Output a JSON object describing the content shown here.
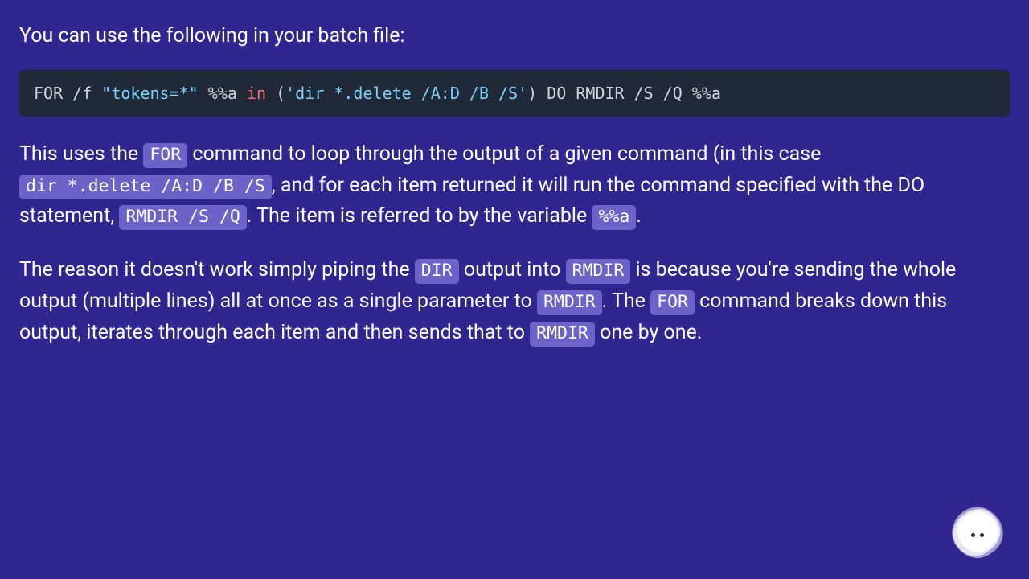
{
  "intro": "You can use the following in your batch file:",
  "code": {
    "t1": "FOR /f ",
    "str": "\"tokens=*\"",
    "t2": " %%a ",
    "kw": "in",
    "t3": " (",
    "str2": "'dir *.delete /A:D /B /S'",
    "t4": ") DO RMDIR /S /Q %%a"
  },
  "p1": {
    "a": "This uses the ",
    "c1": "FOR",
    "b": " command to loop through the output of a given command (in this case ",
    "c2": "dir *.delete /A:D /B /S",
    "c": ", and for each item returned it will run the command specified with the DO statement, ",
    "c3": "RMDIR /S /Q",
    "d": ". The item is referred to by the variable ",
    "c4": "%%a",
    "e": "."
  },
  "p2": {
    "a": "The reason it doesn't work simply piping the ",
    "c1": "DIR",
    "b": " output into ",
    "c2": "RMDIR",
    "c": " is because you're sending the whole output (multiple lines) all at once as a single parameter to ",
    "c3": "RMDIR",
    "d": ". The ",
    "c4": "FOR",
    "e": " command breaks down this output, iterates through each item and then sends that to ",
    "c5": "RMDIR",
    "f": " one by one."
  }
}
